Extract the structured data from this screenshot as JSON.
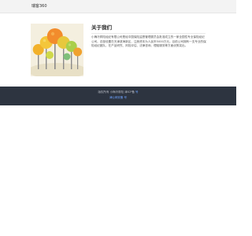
{
  "header": {
    "brand": "瑞客360"
  },
  "about": {
    "title": "关于我们",
    "body": "小梅冷胖险经纪有限公司是经中国保险监督管理委员会批准成立的一家全国性专业保险经纪公司。总部设置在天津滨海新区，注册资本为人民币5000万元。目前公司拥有一支专业的保险经纪团队，在产品研究、风险评估、法律咨询、理赔服务等方面优势突出。"
  },
  "footer": {
    "copyright_label": "版权所有",
    "company_name": "小梅冷胖险",
    "sep": "  ",
    "icp_label": "津ICP备",
    "icp_link": "号",
    "public_security": "津公网安备 号"
  },
  "colors": {
    "topbar_bg": "#f3f3f3",
    "footer_bg": "#2d3440",
    "link": "#6ea3ff"
  }
}
